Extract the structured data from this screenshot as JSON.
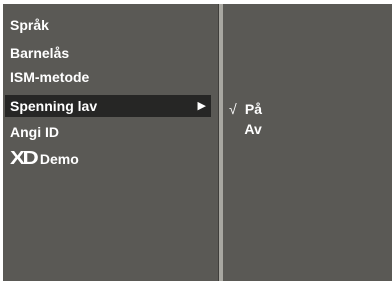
{
  "menu": {
    "items": [
      {
        "label": "Språk"
      },
      {
        "label": "Barnelås"
      },
      {
        "label": "ISM-metode"
      },
      {
        "label": "Spenning lav",
        "selected": true,
        "arrow": "▶"
      },
      {
        "label": "Angi ID"
      },
      {
        "logo": "XD",
        "label": "Demo"
      }
    ]
  },
  "submenu": {
    "options": [
      {
        "check": "√",
        "label": "På",
        "checked": true
      },
      {
        "check": "",
        "label": "Av",
        "checked": false
      }
    ]
  }
}
